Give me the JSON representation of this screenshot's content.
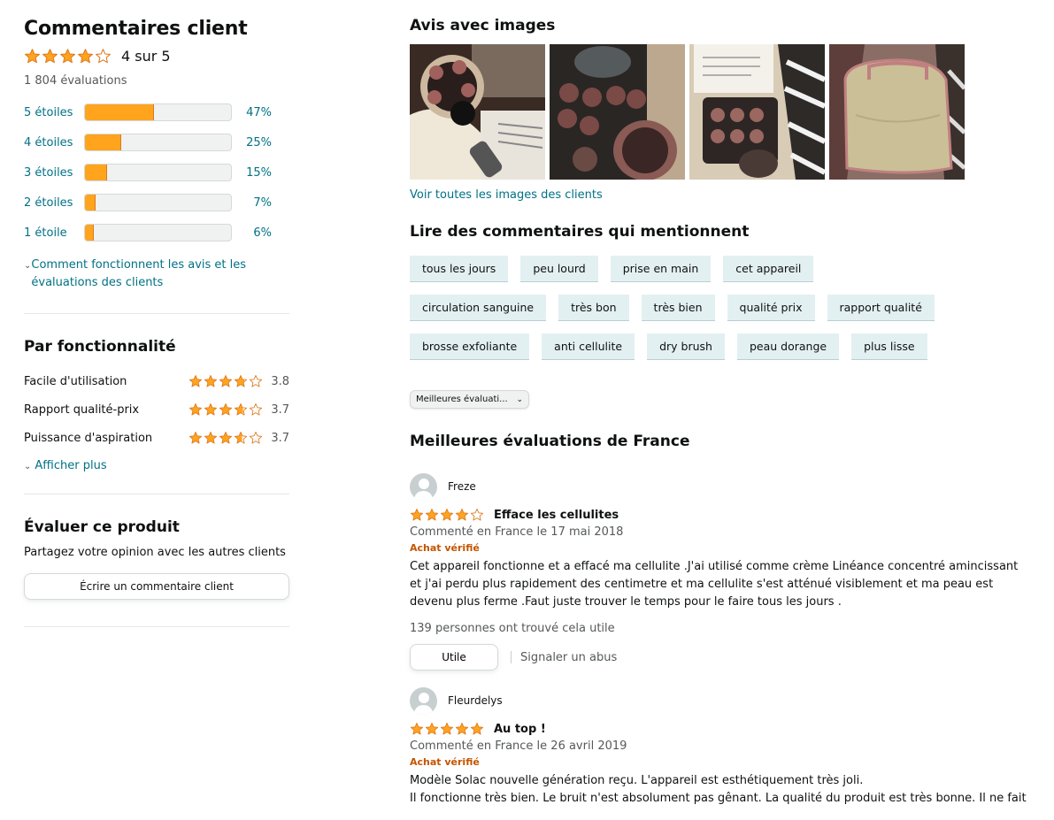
{
  "summary": {
    "title": "Commentaires client",
    "rating": 4,
    "rating_text": "4 sur 5",
    "total": "1 804 évaluations",
    "histogram": [
      {
        "label": "5 étoiles",
        "pct_text": "47%",
        "pct": 47
      },
      {
        "label": "4 étoiles",
        "pct_text": "25%",
        "pct": 25
      },
      {
        "label": "3 étoiles",
        "pct_text": "15%",
        "pct": 15
      },
      {
        "label": "2 étoiles",
        "pct_text": "7%",
        "pct": 7
      },
      {
        "label": "1 étoile",
        "pct_text": "6%",
        "pct": 6
      }
    ],
    "how_link": "Comment fonctionnent les avis et les évaluations des clients"
  },
  "features": {
    "title": "Par fonctionnalité",
    "items": [
      {
        "name": "Facile d'utilisation",
        "rating": 3.8,
        "value": "3.8"
      },
      {
        "name": "Rapport qualité-prix",
        "rating": 3.7,
        "value": "3.7"
      },
      {
        "name": "Puissance d'aspiration",
        "rating": 3.6,
        "value": "3.7"
      }
    ],
    "more": "Afficher plus"
  },
  "evaluate": {
    "title": "Évaluer ce produit",
    "subtitle": "Partagez votre opinion avec les autres clients",
    "button": "Écrire un commentaire client"
  },
  "images_section": {
    "title": "Avis avec images",
    "see_all": "Voir toutes les images des clients"
  },
  "mentions": {
    "title": "Lire des commentaires qui mentionnent",
    "tags": [
      "tous les jours",
      "peu lourd",
      "prise en main",
      "cet appareil",
      "circulation sanguine",
      "très bon",
      "très bien",
      "qualité prix",
      "rapport qualité",
      "brosse exfoliante",
      "anti cellulite",
      "dry brush",
      "peau dorange",
      "plus lisse"
    ]
  },
  "sort": {
    "selected": "Meilleures évaluati..."
  },
  "reviews_section": {
    "title": "Meilleures évaluations de France"
  },
  "reviews": [
    {
      "author": "Freze",
      "rating": 4,
      "title": "Efface les cellulites",
      "date": "Commenté en France le 17 mai 2018",
      "verified": "Achat vérifié",
      "body": "Cet appareil fonctionne et a effacé ma cellulite .J'ai utilisé comme crème Linéance concentré amincissant et j'ai perdu plus rapidement des centimetre et ma cellulite s'est atténué visiblement et ma peau est devenu plus ferme .Faut juste trouver le temps pour le faire tous les jours .",
      "helpful": "139 personnes ont trouvé cela utile",
      "helpful_button": "Utile",
      "report": "Signaler un abus"
    },
    {
      "author": "Fleurdelys",
      "rating": 5,
      "title": "Au top !",
      "date": "Commenté en France le 26 avril 2019",
      "verified": "Achat vérifié",
      "body_lines": [
        "Modèle Solac nouvelle génération reçu. L'appareil est esthétiquement très joli.",
        "Il fonctionne très bien. Le bruit n'est absolument pas gênant. La qualité du produit est très bonne. Il ne fait"
      ]
    }
  ],
  "colors": {
    "star": "#ffa41c",
    "star_stroke": "#de7921",
    "link": "#007185",
    "verified": "#c45500"
  }
}
